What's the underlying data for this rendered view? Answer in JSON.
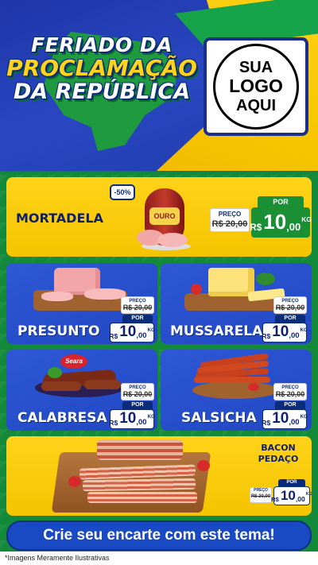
{
  "header": {
    "title_line1": "FERIADO DA",
    "title_line2": "PROCLAMAÇÃO",
    "title_line3": "DA REPÚBLICA",
    "logo_line1": "SUA",
    "logo_line2": "LOGO",
    "logo_line3": "AQUI"
  },
  "featured": {
    "name": "MORTADELA",
    "discount": "-50%",
    "brand": "OURO",
    "preco_label": "PREÇO",
    "old_price": "R$ 20,00",
    "por_label": "POR",
    "currency": "R$",
    "price_int": "10",
    "price_dec": ",00",
    "unit": "KG"
  },
  "products": [
    {
      "name": "PRESUNTO",
      "preco_label": "PREÇO",
      "old_price": "R$ 20,00",
      "por_label": "POR",
      "currency": "R$",
      "price_int": "10",
      "price_dec": ",00",
      "unit": "KG"
    },
    {
      "name": "MUSSARELA",
      "preco_label": "PREÇO",
      "old_price": "R$ 20,00",
      "por_label": "POR",
      "currency": "R$",
      "price_int": "10",
      "price_dec": ",00",
      "unit": "KG"
    },
    {
      "name": "CALABRESA",
      "brand": "Seara",
      "preco_label": "PREÇO",
      "old_price": "R$ 20,00",
      "por_label": "POR",
      "currency": "R$",
      "price_int": "10",
      "price_dec": ",00",
      "unit": "KG"
    },
    {
      "name": "SALSICHA",
      "preco_label": "PREÇO",
      "old_price": "R$ 20,00",
      "por_label": "POR",
      "currency": "R$",
      "price_int": "10",
      "price_dec": ",00",
      "unit": "KG"
    }
  ],
  "bacon": {
    "name_line1": "BACON",
    "name_line2": "PEDAÇO",
    "preco_label": "PREÇO",
    "old_price": "R$ 20,00",
    "por_label": "POR",
    "currency": "R$",
    "price_int": "10",
    "price_dec": ",00",
    "unit": "KG"
  },
  "footer": {
    "cta": "Crie seu encarte com este tema!",
    "disclaimer": "*Imagens Meramente Ilustrativas"
  },
  "colors": {
    "blue": "#2247c2",
    "yellow": "#ffd31a",
    "green": "#1a8f34",
    "navy": "#0d1f6e"
  }
}
